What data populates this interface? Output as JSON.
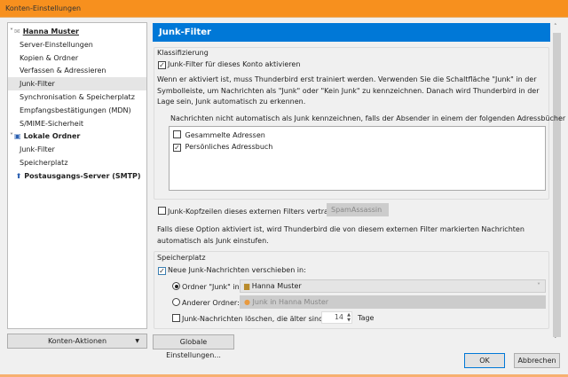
{
  "window": {
    "title": "Konten-Einstellungen"
  },
  "tree": {
    "items": [
      {
        "label": "Hanna Muster",
        "kind": "account",
        "icon": "mail-account-icon"
      },
      {
        "label": "Server-Einstellungen"
      },
      {
        "label": "Kopien & Ordner"
      },
      {
        "label": "Verfassen & Adressieren"
      },
      {
        "label": "Junk-Filter",
        "selected": true
      },
      {
        "label": "Synchronisation & Speicherplatz"
      },
      {
        "label": "Empfangsbestätigungen (MDN)"
      },
      {
        "label": "S/MIME-Sicherheit"
      },
      {
        "label": "Lokale Ordner",
        "kind": "account",
        "icon": "computer-icon"
      },
      {
        "label": "Junk-Filter"
      },
      {
        "label": "Speicherplatz"
      },
      {
        "label": "Postausgangs-Server (SMTP)",
        "kind": "account",
        "icon": "globe-icon"
      }
    ]
  },
  "account_actions": "Konten-Aktionen",
  "panel": {
    "title": "Junk-Filter",
    "classification": {
      "legend": "Klassifizierung",
      "enable_label": "Junk-Filter für dieses Konto aktivieren",
      "enable_checked": true,
      "description": "Wenn er aktiviert ist, muss Thunderbird erst trainiert werden. Verwenden Sie die Schaltfläche \"Junk\" in der Symbolleiste, um Nachrichten als \"Junk\" oder \"Kein Junk\" zu kennzeichnen. Danach wird Thunderbird in der Lage sein, Junk automatisch zu erkennen.",
      "whitelist_label": "Nachrichten nicht automatisch als Junk kennzeichnen, falls der Absender in einem der folgenden Adressbücher ist:",
      "address_books": [
        {
          "label": "Gesammelte Adressen",
          "checked": false
        },
        {
          "label": "Persönliches Adressbuch",
          "checked": true
        }
      ]
    },
    "external": {
      "label": "Junk-Kopfzeilen dieses externen Filters vertrauen:",
      "checked": false,
      "filter_value": "SpamAssassin",
      "description": "Falls diese Option aktiviert ist, wird Thunderbird die von diesem externen Filter markierten Nachrichten automatisch als Junk einstufen."
    },
    "storage": {
      "legend": "Speicherplatz",
      "move_label": "Neue Junk-Nachrichten verschieben in:",
      "move_checked": true,
      "junk_folder_label": "Ordner \"Junk\" in:",
      "junk_folder_value": "Hanna Muster",
      "junk_folder_selected": true,
      "other_folder_label": "Anderer Ordner:",
      "other_folder_value": "Junk in Hanna Muster",
      "delete_label": "Junk-Nachrichten löschen, die älter sind als",
      "delete_checked": false,
      "days": "14",
      "days_unit": "Tage"
    }
  },
  "buttons": {
    "global": "Globale Einstellungen...",
    "ok": "OK",
    "cancel": "Abbrechen"
  }
}
